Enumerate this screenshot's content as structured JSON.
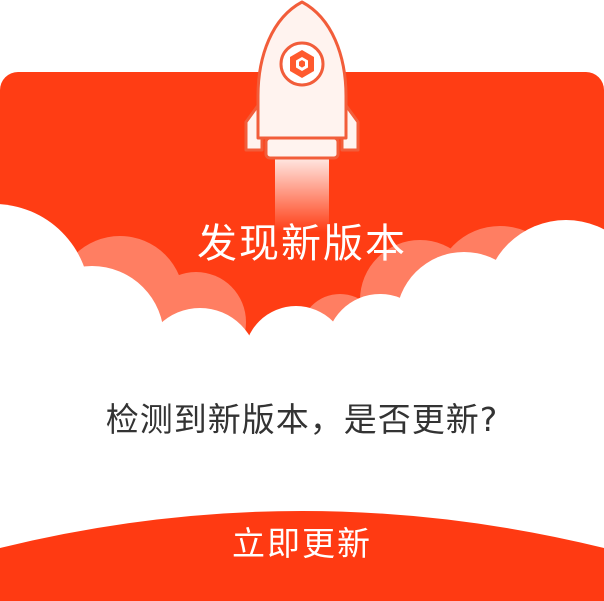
{
  "dialog": {
    "title": "发现新版本",
    "message": "检测到新版本，是否更新?",
    "update_button_label": "立即更新"
  },
  "icons": {
    "rocket": "rocket-icon",
    "app_logo": "app-logo-icon"
  },
  "colors": {
    "banner_red": "#ff3d14",
    "cloud_salmon": "#ff7e62",
    "cloud_white": "#ffffff",
    "rocket_body": "#fff3ef",
    "rocket_outline": "#f25d3a",
    "button_red": "#ff3a12",
    "text_dark": "#333333"
  }
}
